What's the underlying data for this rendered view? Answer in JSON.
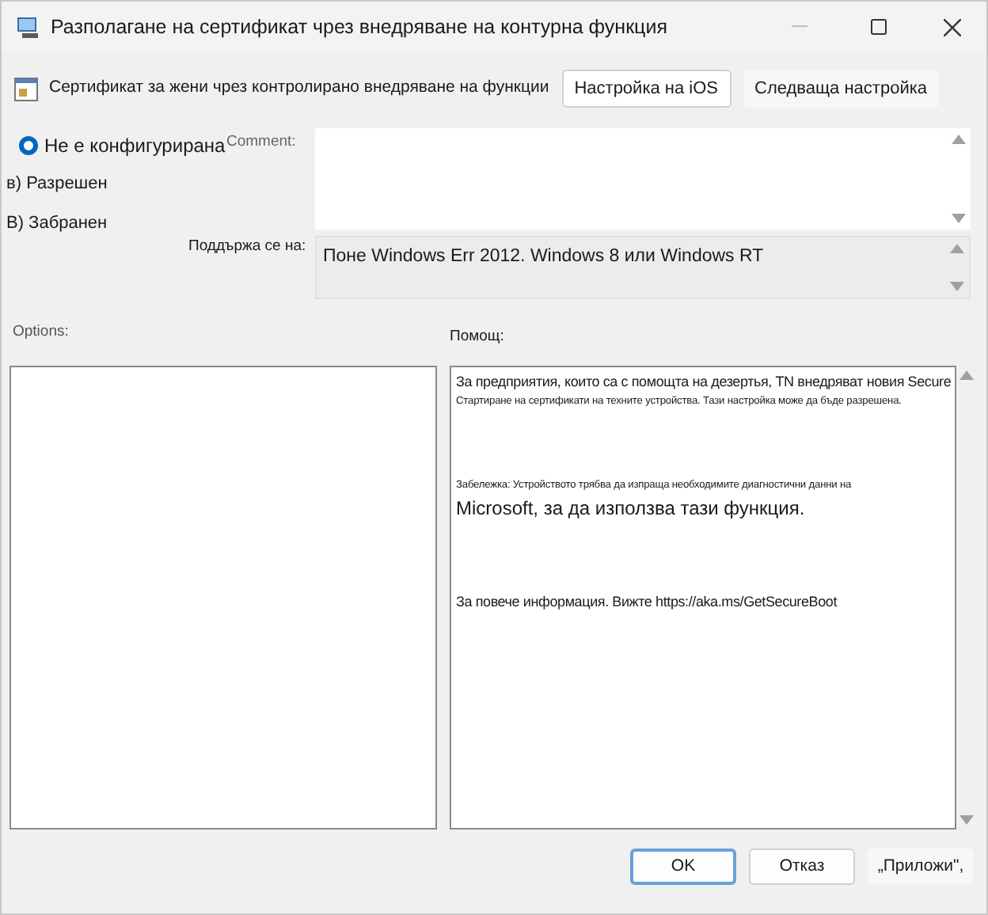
{
  "window": {
    "title": "Разполагане на сертификат чрез внедряване на контурна функция"
  },
  "header": {
    "policy_name": "Сертификат за жени чрез контролирано внедряване на функции",
    "buttons": [
      {
        "label": "Настройка на iOS",
        "selected": true
      },
      {
        "label": "Следваща настройка",
        "selected": false
      }
    ]
  },
  "options": [
    {
      "label": "Не е конфигурирана",
      "selected": true
    },
    {
      "label": "в) Разрешен",
      "selected": false
    },
    {
      "label": "В) Забранен",
      "selected": false
    }
  ],
  "comment": {
    "label": "Comment:"
  },
  "supported": {
    "label": "Поддържа се на:",
    "value": "Поне Windows Err 2012. Windows 8 или Windows RT"
  },
  "options_label": "Options:",
  "help": {
    "label": "Помощ:",
    "lines": [
      {
        "kind": "normal",
        "text": "За предприятия, които са с помощта на дезертья, TN внедряват новия Secure"
      },
      {
        "kind": "tiny",
        "text": "Стартиране на сертификати на техните устройства. Тази настройка може да бъде разрешена."
      },
      {
        "kind": "gap"
      },
      {
        "kind": "tiny",
        "text": "Забележка: Устройството трябва да изпраща необходимите диагностични данни на"
      },
      {
        "kind": "large",
        "text": "Microsoft, за да използва тази функция."
      },
      {
        "kind": "gap"
      },
      {
        "kind": "normal",
        "text": "За повече информация. Вижте https://aka.ms/GetSecureBoot"
      }
    ]
  },
  "footer": {
    "buttons": [
      {
        "label": "OK",
        "selected": true
      },
      {
        "label": "Отказ",
        "selected": false
      },
      {
        "label": "„Приложи\",",
        "selected": false
      }
    ]
  }
}
